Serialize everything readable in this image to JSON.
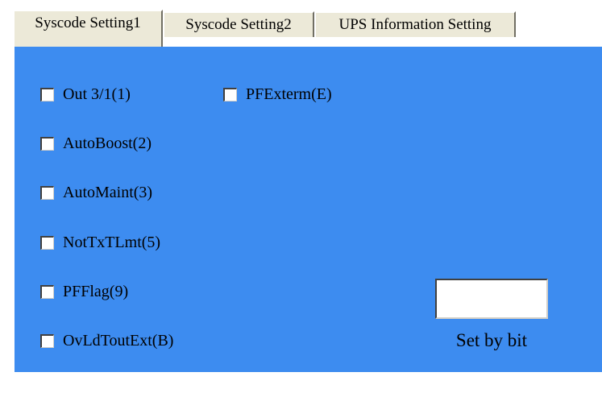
{
  "tabs": [
    {
      "label": "Syscode Setting1",
      "active": true
    },
    {
      "label": "Syscode Setting2",
      "active": false
    },
    {
      "label": "UPS Information Setting",
      "active": false
    }
  ],
  "checkboxes": {
    "out31": {
      "label": "Out 3/1(1)",
      "checked": false
    },
    "pfexterm": {
      "label": "PFExterm(E)",
      "checked": false
    },
    "autoboost": {
      "label": "AutoBoost(2)",
      "checked": false
    },
    "automaint": {
      "label": "AutoMaint(3)",
      "checked": false
    },
    "nottxtlmt": {
      "label": "NotTxTLmt(5)",
      "checked": false
    },
    "pfflag": {
      "label": "PFFlag(9)",
      "checked": false
    },
    "ovldtoutext": {
      "label": "OvLdToutExt(B)",
      "checked": false
    }
  },
  "set_by_bit": {
    "label": "Set by bit",
    "value": ""
  },
  "colors": {
    "panel": "#3d8cf0",
    "tab_face": "#ece9d8"
  }
}
